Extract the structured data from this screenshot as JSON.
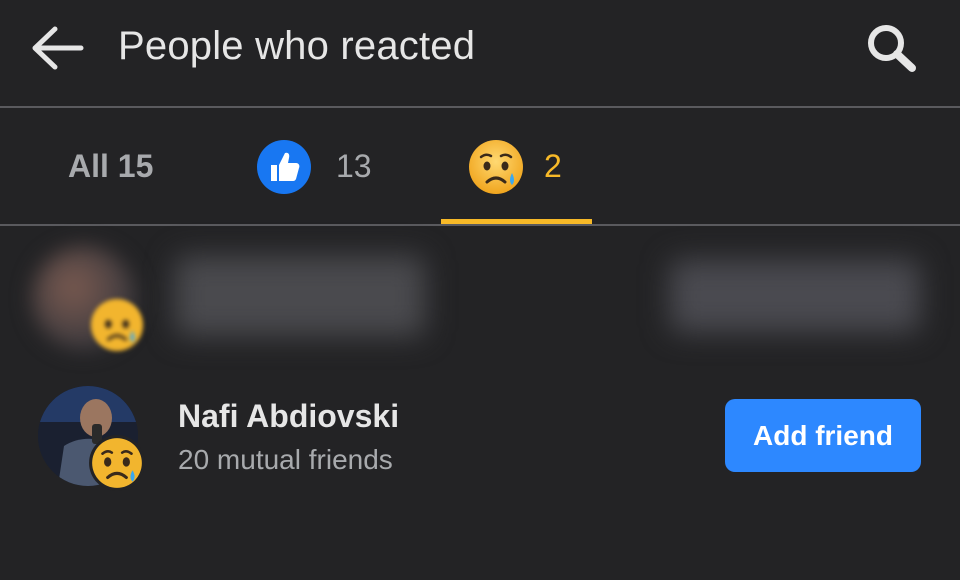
{
  "header": {
    "title": "People who reacted",
    "back_icon": "arrow-left-icon",
    "search_icon": "search-icon"
  },
  "tabs": [
    {
      "label": "All 15",
      "selected": false
    },
    {
      "icon": "like-reaction-icon",
      "count": "13",
      "selected": false
    },
    {
      "icon": "sad-reaction-icon",
      "count": "2",
      "selected": true
    }
  ],
  "colors": {
    "background": "#232325",
    "accent": "#f7b928",
    "button": "#2d88ff",
    "like_blue": "#1877f2"
  },
  "people": [
    {
      "name": "",
      "reaction": "sad-reaction-icon",
      "blurred": true
    },
    {
      "name": "Nafi Abdiovski",
      "subtitle": "20 mutual friends",
      "reaction": "sad-reaction-icon",
      "button_label": "Add friend"
    }
  ]
}
